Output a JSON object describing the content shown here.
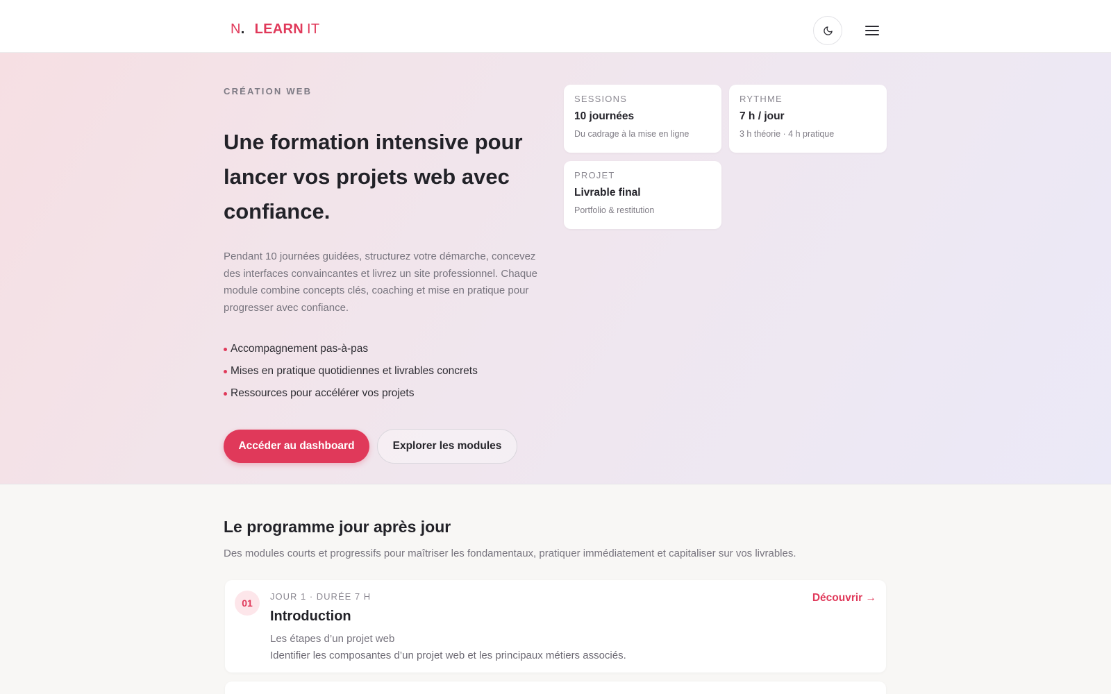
{
  "header": {
    "logo": {
      "mark": "N",
      "dot": ".",
      "learn": "LEARN",
      "it": "IT"
    },
    "theme_toggle_icon": "moon-icon",
    "menu_icon": "hamburger-menu-icon"
  },
  "hero": {
    "eyebrow": "CRÉATION WEB",
    "title": "Une formation intensive pour lancer vos projets web avec confiance.",
    "description": "Pendant 10 journées guidées, structurez votre démarche, concevez des interfaces convaincantes et livrez un site professionnel. Chaque module combine concepts clés, coaching et mise en pratique pour progresser avec confiance.",
    "features": [
      "Accompagnement pas-à-pas",
      "Mises en pratique quotidiennes et livrables concrets",
      "Ressources pour accélérer vos projets"
    ],
    "cta_primary": "Accéder au dashboard",
    "cta_secondary": "Explorer les modules"
  },
  "stats": [
    {
      "label": "SESSIONS",
      "value": "10 journées",
      "sub": "Du cadrage à la mise en ligne"
    },
    {
      "label": "RYTHME",
      "value": "7 h / jour",
      "sub": "3 h théorie · 4 h pratique"
    },
    {
      "label": "PROJET",
      "value": "Livrable final",
      "sub": "Portfolio & restitution"
    }
  ],
  "programme": {
    "title": "Le programme jour après jour",
    "description": "Des modules courts et progressifs pour maîtriser les fondamentaux, pratiquer immédiatement et capitaliser sur vos livrables.",
    "modules": [
      {
        "number": "01",
        "meta": "JOUR 1 ·  DURÉE 7 H",
        "title": "Introduction",
        "subtitle": "Les étapes d’un projet web",
        "summary": "Identifier les composantes d’un projet web et les principaux métiers associés.",
        "link": "Découvrir →"
      }
    ]
  },
  "colors": {
    "accent": "#e0395a",
    "text": "#222228",
    "muted": "#77747e",
    "background": "#f8f7f5"
  }
}
